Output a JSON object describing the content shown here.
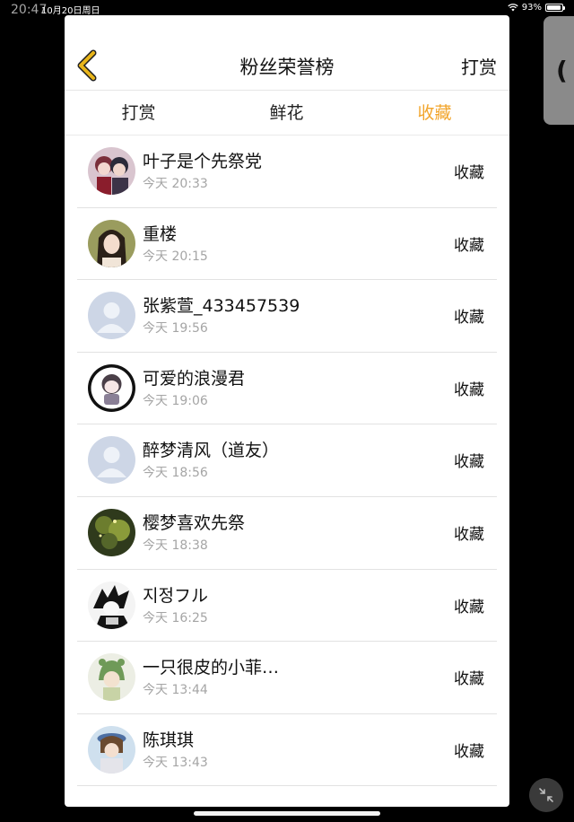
{
  "status": {
    "time": "20:47",
    "date": "10月20日周日",
    "battery": "93%",
    "battery_level": 0.93
  },
  "header": {
    "title": "粉丝荣誉榜",
    "action": "打赏"
  },
  "tabs": [
    {
      "label": "打赏",
      "active": false
    },
    {
      "label": "鲜花",
      "active": false
    },
    {
      "label": "收藏",
      "active": true
    }
  ],
  "colors": {
    "accent": "#f2a52c",
    "back_icon": "#e8b51a"
  },
  "list": [
    {
      "name": "叶子是个先祭党",
      "time": "今天 20:33",
      "action": "收藏",
      "avatar": "anime-duo-avatar"
    },
    {
      "name": "重楼",
      "time": "今天 20:15",
      "action": "收藏",
      "avatar": "anime-girl-avatar"
    },
    {
      "name": "张紫萱_433457539",
      "time": "今天 19:56",
      "action": "收藏",
      "avatar": "default-user-avatar"
    },
    {
      "name": "可爱的浪漫君",
      "time": "今天 19:06",
      "action": "收藏",
      "avatar": "chibi-avatar"
    },
    {
      "name": "醉梦清风（道友）",
      "time": "今天 18:56",
      "action": "收藏",
      "avatar": "default-user-avatar"
    },
    {
      "name": "樱梦喜欢先祭",
      "time": "今天 18:38",
      "action": "收藏",
      "avatar": "forest-avatar"
    },
    {
      "name": "지정フル",
      "time": "今天 16:25",
      "action": "收藏",
      "avatar": "ink-sketch-avatar"
    },
    {
      "name": "一只很皮的小菲…",
      "time": "今天 13:44",
      "action": "收藏",
      "avatar": "green-hair-avatar"
    },
    {
      "name": "陈琪琪",
      "time": "今天 13:43",
      "action": "收藏",
      "avatar": "hat-girl-avatar"
    }
  ]
}
